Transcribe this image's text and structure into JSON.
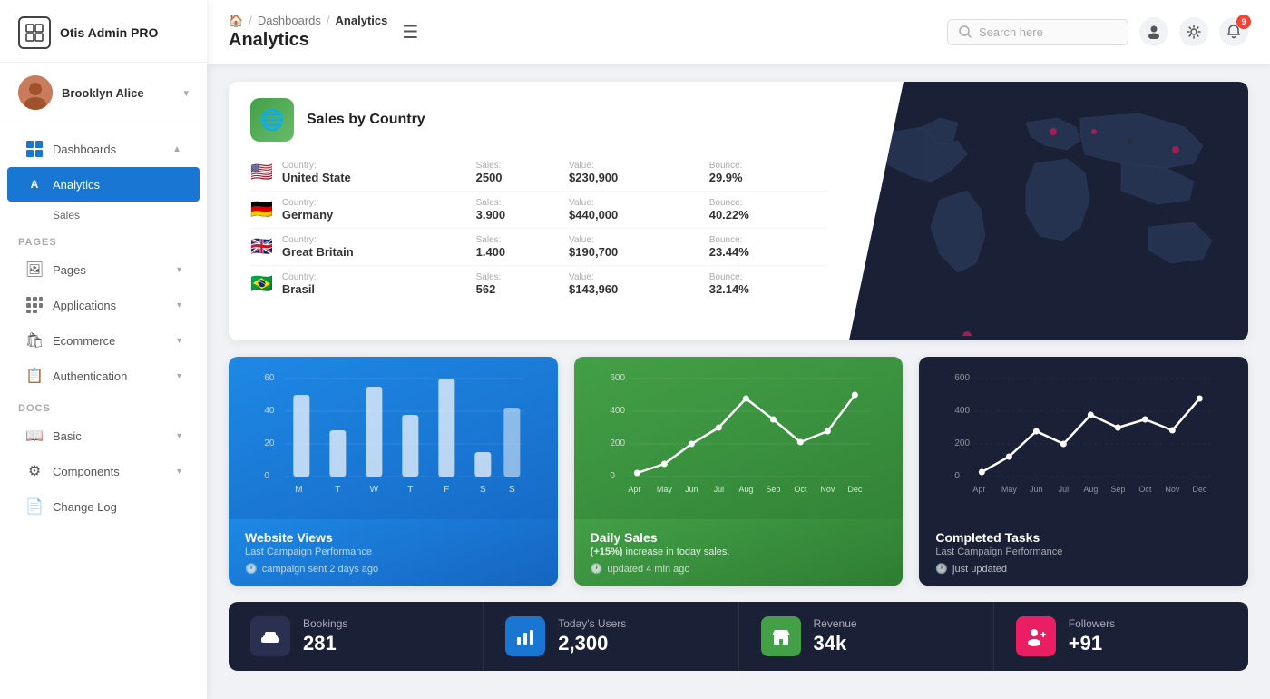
{
  "app": {
    "name": "Otis Admin PRO"
  },
  "user": {
    "name": "Brooklyn Alice"
  },
  "sidebar": {
    "section_pages": "PAGES",
    "section_docs": "DOCS",
    "nav": [
      {
        "id": "dashboards",
        "label": "Dashboards",
        "icon": "⊞",
        "expanded": true,
        "active": false
      },
      {
        "id": "analytics",
        "label": "Analytics",
        "icon": "A",
        "active": true,
        "sub": true
      },
      {
        "id": "sales",
        "label": "Sales",
        "icon": "S",
        "active": false,
        "sub": true
      },
      {
        "id": "pages",
        "label": "Pages",
        "icon": "🖼",
        "active": false
      },
      {
        "id": "applications",
        "label": "Applications",
        "icon": "⚏",
        "active": false
      },
      {
        "id": "ecommerce",
        "label": "Ecommerce",
        "icon": "🛍",
        "active": false
      },
      {
        "id": "authentication",
        "label": "Authentication",
        "icon": "📋",
        "active": false
      },
      {
        "id": "basic",
        "label": "Basic",
        "icon": "📖",
        "active": false
      },
      {
        "id": "components",
        "label": "Components",
        "icon": "⚙",
        "active": false
      },
      {
        "id": "changelog",
        "label": "Change Log",
        "icon": "📄",
        "active": false
      }
    ]
  },
  "header": {
    "breadcrumb": {
      "home": "🏠",
      "sep1": "/",
      "link1": "Dashboards",
      "sep2": "/",
      "current": "Analytics"
    },
    "title": "Analytics",
    "menu_icon": "☰",
    "search_placeholder": "Search here",
    "notification_count": "9"
  },
  "sales_by_country": {
    "title": "Sales by Country",
    "columns": {
      "country": "Country:",
      "sales": "Sales:",
      "value": "Value:",
      "bounce": "Bounce:"
    },
    "rows": [
      {
        "flag": "🇺🇸",
        "country": "United State",
        "sales": "2500",
        "value": "$230,900",
        "bounce": "29.9%"
      },
      {
        "flag": "🇩🇪",
        "country": "Germany",
        "sales": "3.900",
        "value": "$440,000",
        "bounce": "40.22%"
      },
      {
        "flag": "🇬🇧",
        "country": "Great Britain",
        "sales": "1.400",
        "value": "$190,700",
        "bounce": "23.44%"
      },
      {
        "flag": "🇧🇷",
        "country": "Brasil",
        "sales": "562",
        "value": "$143,960",
        "bounce": "32.14%"
      }
    ]
  },
  "charts": [
    {
      "id": "website-views",
      "title": "Website Views",
      "subtitle": "Last Campaign Performance",
      "footer": "campaign sent 2 days ago",
      "type": "bar",
      "labels": [
        "M",
        "T",
        "W",
        "T",
        "F",
        "S",
        "S"
      ],
      "values": [
        45,
        28,
        55,
        38,
        60,
        15,
        42
      ],
      "y_max": 60,
      "y_labels": [
        "60",
        "40",
        "20",
        "0"
      ]
    },
    {
      "id": "daily-sales",
      "title": "Daily Sales",
      "subtitle": "(+15%) increase in today sales.",
      "footer": "updated 4 min ago",
      "type": "line",
      "labels": [
        "Apr",
        "May",
        "Jun",
        "Jul",
        "Aug",
        "Sep",
        "Oct",
        "Nov",
        "Dec"
      ],
      "values": [
        20,
        80,
        200,
        300,
        480,
        350,
        210,
        280,
        500
      ],
      "y_max": 600,
      "y_labels": [
        "600",
        "400",
        "200",
        "0"
      ]
    },
    {
      "id": "completed-tasks",
      "title": "Completed Tasks",
      "subtitle": "Last Campaign Performance",
      "footer": "just updated",
      "type": "line",
      "labels": [
        "Apr",
        "May",
        "Jun",
        "Jul",
        "Aug",
        "Sep",
        "Oct",
        "Nov",
        "Dec"
      ],
      "values": [
        30,
        120,
        280,
        200,
        380,
        300,
        350,
        280,
        480
      ],
      "y_max": 600,
      "y_labels": [
        "600",
        "400",
        "200",
        "0"
      ]
    }
  ],
  "stats": [
    {
      "id": "bookings",
      "label": "Bookings",
      "value": "281",
      "icon": "🛋",
      "icon_style": "dark"
    },
    {
      "id": "today-users",
      "label": "Today's Users",
      "value": "2,300",
      "icon": "📊",
      "icon_style": "blue"
    },
    {
      "id": "revenue",
      "label": "Revenue",
      "value": "34k",
      "icon": "🏪",
      "icon_style": "green"
    },
    {
      "id": "followers",
      "label": "Followers",
      "value": "+91",
      "icon": "👤",
      "icon_style": "pink"
    }
  ]
}
